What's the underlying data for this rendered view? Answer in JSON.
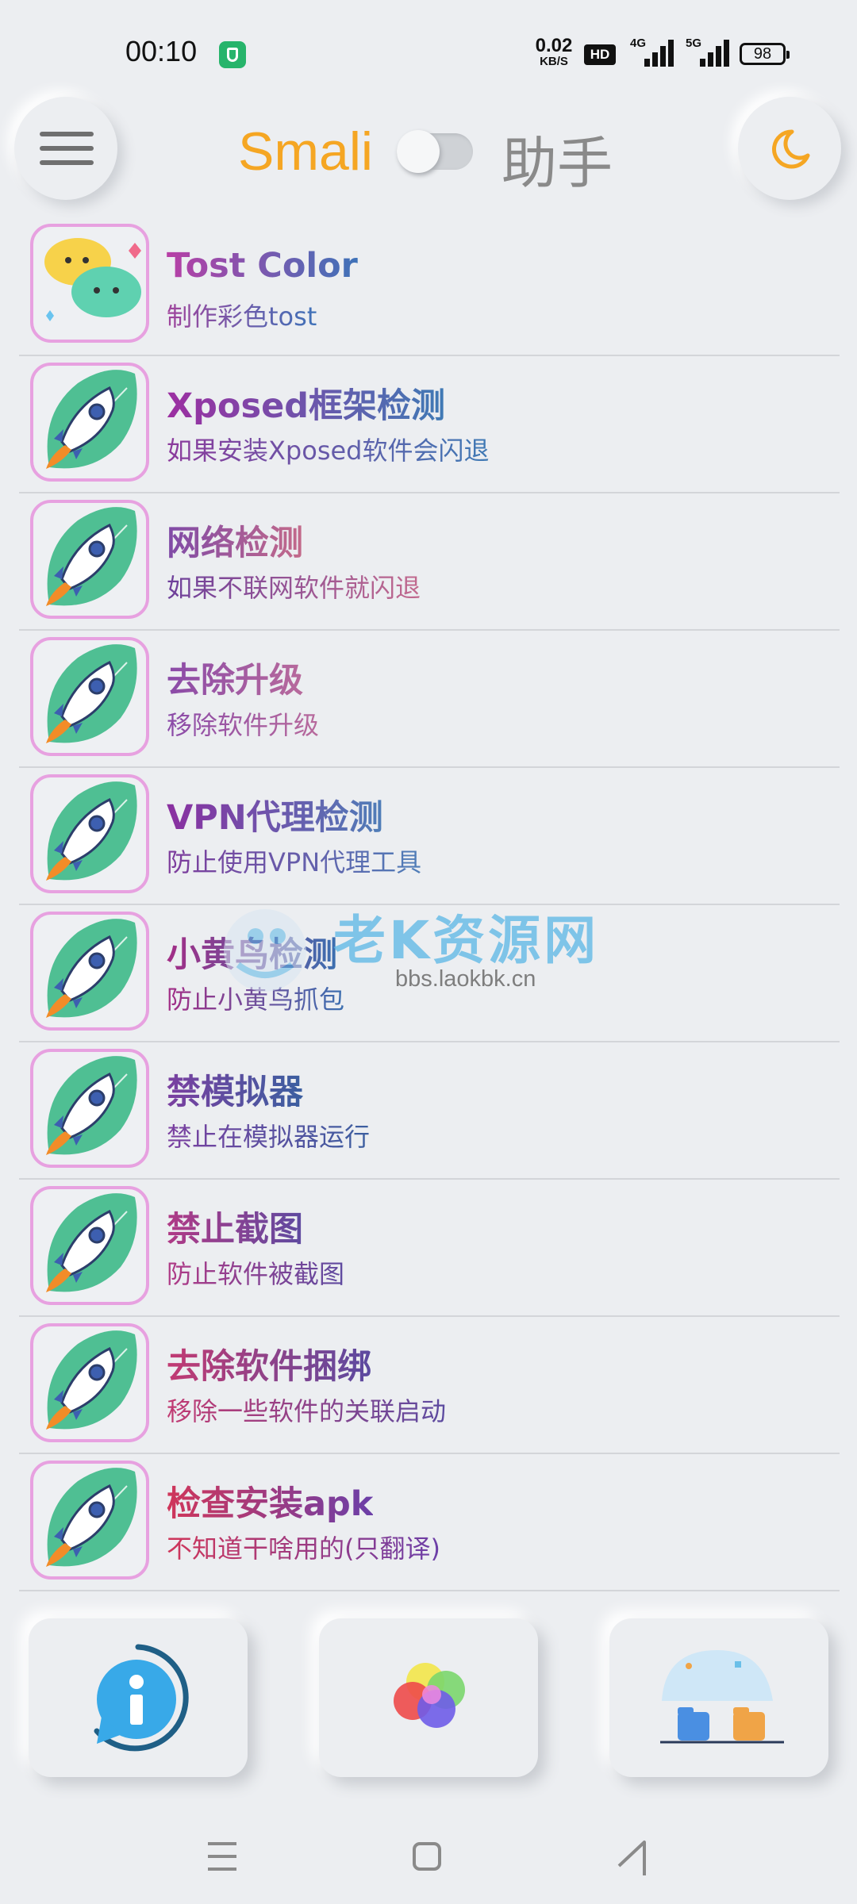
{
  "status_bar": {
    "time": "00:10",
    "net_speed_value": "0.02",
    "net_speed_unit": "KB/S",
    "hd_label": "HD",
    "signal1_label": "4G",
    "signal2_label": "5G",
    "battery": "98"
  },
  "header": {
    "title_left": "Smali",
    "title_right": "助手",
    "toggle_on": false,
    "menu_icon": "hamburger-icon",
    "theme_icon": "moon-icon"
  },
  "items": [
    {
      "title": "Tost Color",
      "subtitle": "制作彩色tost",
      "icon": "chat-bubbles-icon",
      "title_color": "#b83fa6",
      "title_color2": "#3e72b8",
      "sub_color": "#a0449c",
      "sub_color2": "#3e72b8"
    },
    {
      "title": "Xposed框架检测",
      "subtitle": "如果安装Xposed软件会闪退",
      "icon": "rocket-icon",
      "title_color": "#9c2ea1",
      "title_color2": "#3f7ab5",
      "sub_color": "#8c3a9c",
      "sub_color2": "#3f7ab5"
    },
    {
      "title": "网络检测",
      "subtitle": "如果不联网软件就闪退",
      "icon": "rocket-icon",
      "title_color": "#7f4aa7",
      "title_color2": "#c46a8a",
      "sub_color": "#6d3f9a",
      "sub_color2": "#c26a8e"
    },
    {
      "title": "去除升级",
      "subtitle": "移除软件升级",
      "icon": "rocket-icon",
      "title_color": "#8a4aa8",
      "title_color2": "#b86a9c",
      "sub_color": "#8a4aa8",
      "sub_color2": "#b86a9c"
    },
    {
      "title": "VPN代理检测",
      "subtitle": "防止使用VPN代理工具",
      "icon": "rocket-icon",
      "title_color": "#8a2fa0",
      "title_color2": "#4f7eb8",
      "sub_color": "#7e3b9c",
      "sub_color2": "#4f7eb8"
    },
    {
      "title": "小黄鸟检测",
      "subtitle": "防止小黄鸟抓包",
      "icon": "rocket-icon",
      "title_color": "#a32d86",
      "title_color2": "#3b6fb0",
      "sub_color": "#a32d86",
      "sub_color2": "#3b6fb0"
    },
    {
      "title": "禁模拟器",
      "subtitle": "禁止在模拟器运行",
      "icon": "rocket-icon",
      "title_color": "#7b3fa0",
      "title_color2": "#3b5fa0",
      "sub_color": "#7b3fa0",
      "sub_color2": "#3b5fa0"
    },
    {
      "title": "禁止截图",
      "subtitle": "防止软件被截图",
      "icon": "rocket-icon",
      "title_color": "#b03a86",
      "title_color2": "#5e4aa0",
      "sub_color": "#b03a86",
      "sub_color2": "#5e4aa0"
    },
    {
      "title": "去除软件捆绑",
      "subtitle": "移除一些软件的关联启动",
      "icon": "rocket-icon",
      "title_color": "#c23a72",
      "title_color2": "#5b4aa0",
      "sub_color": "#c23a72",
      "sub_color2": "#5b4aa0"
    },
    {
      "title": "检查安装apk",
      "subtitle": "不知道干啥用的(只翻译)",
      "icon": "rocket-icon",
      "title_color": "#d0365a",
      "title_color2": "#6b3fa8",
      "sub_color": "#d0365a",
      "sub_color2": "#6b3fa8"
    }
  ],
  "watermark": {
    "text": "老K资源网",
    "url": "bbs.laokbk.cn"
  },
  "bottom_cards": [
    {
      "name": "info-card",
      "icon": "info-icon"
    },
    {
      "name": "color-card",
      "icon": "color-circles-icon"
    },
    {
      "name": "folder-card",
      "icon": "folders-icon"
    }
  ],
  "nav": {
    "menu_icon": "recents-icon",
    "home_icon": "home-icon",
    "back_icon": "back-icon"
  }
}
